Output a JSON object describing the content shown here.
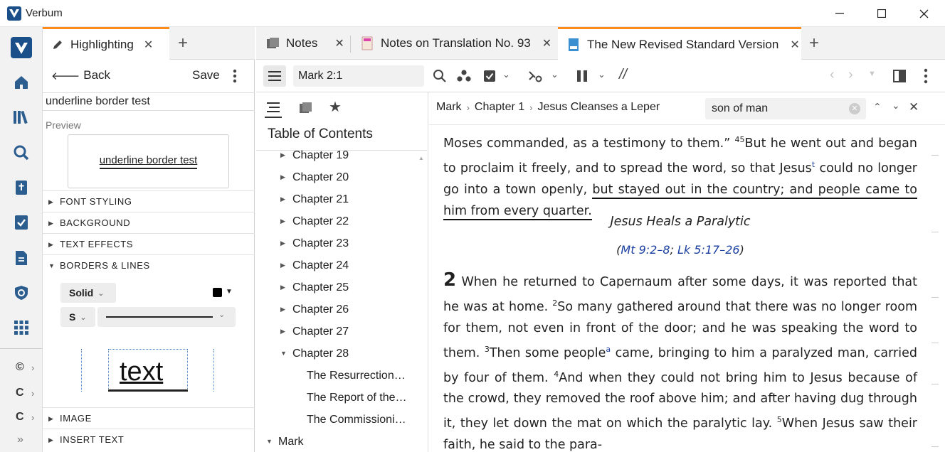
{
  "window": {
    "title": "Verbum",
    "min_icon": "minimize-icon",
    "max_icon": "maximize-icon",
    "close_icon": "close-icon"
  },
  "left_panel": {
    "tabs": [
      {
        "label": "Highlighting",
        "active": true
      }
    ],
    "back_label": "Back",
    "save_label": "Save",
    "style_name": "underline border test",
    "preview_label": "Preview",
    "preview_text": "underline border test",
    "sections": {
      "font_styling": "FONT STYLING",
      "background": "BACKGROUND",
      "text_effects": "TEXT EFFECTS",
      "borders_lines": "BORDERS & LINES",
      "image": "IMAGE",
      "insert_text": "INSERT TEXT"
    },
    "border_style_value": "Solid",
    "size_value": "S",
    "sample_text": "text",
    "line_color": "#000000"
  },
  "sidebar_shortcuts": [
    "©",
    "C",
    "C"
  ],
  "doc_tabs": [
    {
      "label": "Notes",
      "icon": "notes-icon"
    },
    {
      "label": "Notes on Translation No. 93",
      "icon": "book-icon"
    },
    {
      "label": "The New Revised Standard Version",
      "icon": "bible-icon",
      "active": true
    }
  ],
  "toolbar": {
    "reference": "Mark 2:1",
    "search_value": "son of man"
  },
  "toc_tabs": [
    "contents-icon",
    "pages-icon",
    "star-icon"
  ],
  "toc": {
    "title": "Table of Contents",
    "items": [
      {
        "label": "Chapter 19"
      },
      {
        "label": "Chapter 20"
      },
      {
        "label": "Chapter 21"
      },
      {
        "label": "Chapter 22"
      },
      {
        "label": "Chapter 23"
      },
      {
        "label": "Chapter 24"
      },
      {
        "label": "Chapter 25"
      },
      {
        "label": "Chapter 26"
      },
      {
        "label": "Chapter 27"
      },
      {
        "label": "Chapter 28",
        "expanded": true
      }
    ],
    "subitems": [
      "The Resurrection…",
      "The Report of the…",
      "The Commissioni…"
    ],
    "book": "Mark"
  },
  "breadcrumb": [
    "Mark",
    "Chapter 1",
    "Jesus Cleanses a Leper"
  ],
  "reader": {
    "p1_a": "Moses commanded, as a testimony to them.” ",
    "p1_v45": "45",
    "p1_b": "But he went out and began to proclaim it freely, and to spread the word, so that Jesus",
    "p1_fn": "t",
    "p1_c": " could no longer go into a town openly, ",
    "p1_underlined": "but stayed out in the country; and people came to him from every quarter.",
    "heading": "Jesus Heals a Paralytic",
    "xref_open": "(",
    "xref1": "Mt 9:2–8",
    "xref_sep": "; ",
    "xref2": "Lk 5:17–26",
    "xref_close": ")",
    "chapter_num": "2",
    "p2_a": " When he returned to Capernaum after some days, it was reported that he was at home. ",
    "v2": "2",
    "p2_b": "So many gathered around that there was no longer room for them, not even in front of the door; and he was speaking the word to them. ",
    "v3": "3",
    "p2_c": "Then some people",
    "p2_fn": "a",
    "p2_d": " came, bringing to him a paralyzed man, carried by four of them. ",
    "v4": "4",
    "p2_e": "And when they could not bring him to Jesus because of the crowd, they removed the roof above him; and after having dug through it, they let down the mat on which the paralytic lay. ",
    "v5": "5",
    "p2_f": "When Jesus saw their faith, he said to the para-"
  },
  "colors": {
    "accent": "#ff8c1a",
    "brand": "#1b4f8a",
    "link": "#1a3fa0"
  }
}
